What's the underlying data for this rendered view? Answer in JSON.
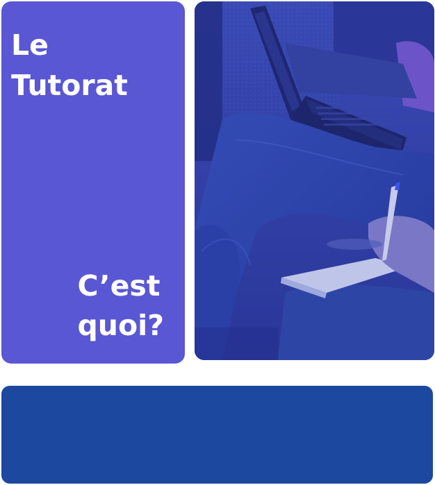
{
  "title_panel": {
    "title_line1": "Le",
    "title_line2": "Tutorat",
    "subtitle_line1": "C’est",
    "subtitle_line2": "quoi?"
  },
  "colors": {
    "title_panel_bg": "#5a57d4",
    "photo_tint": "#2c3aa6",
    "bottom_bar_bg": "#1d48a0"
  },
  "photo": {
    "subject": "students-with-laptop-and-notepad-photo"
  }
}
